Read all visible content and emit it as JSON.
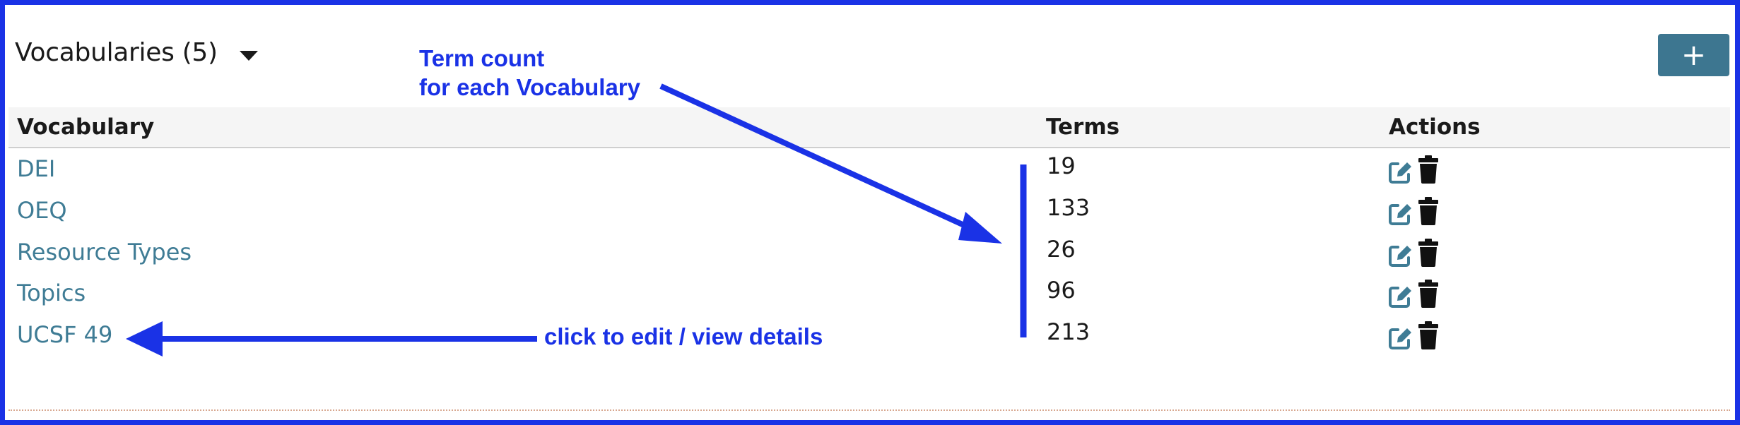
{
  "panel": {
    "title": "Vocabularies (5)",
    "add_label": "+"
  },
  "table": {
    "headers": {
      "vocabulary": "Vocabulary",
      "terms": "Terms",
      "actions": "Actions"
    },
    "rows": [
      {
        "name": "DEI",
        "terms": "19"
      },
      {
        "name": "OEQ",
        "terms": "133"
      },
      {
        "name": "Resource Types",
        "terms": "26"
      },
      {
        "name": "Topics",
        "terms": "96"
      },
      {
        "name": "UCSF 49",
        "terms": "213"
      }
    ]
  },
  "annotations": {
    "term_count_line1": "Term count",
    "term_count_line2": "for each Vocabulary",
    "click_hint": "click to edit / view details"
  },
  "colors": {
    "frame": "#1a32e6",
    "link": "#3f7c95",
    "add_button": "#3d7690",
    "annotation": "#1a32e6"
  },
  "icons": {
    "dropdown": "caret-down-icon",
    "edit": "edit-icon",
    "delete": "trash-icon",
    "add": "plus-icon"
  }
}
